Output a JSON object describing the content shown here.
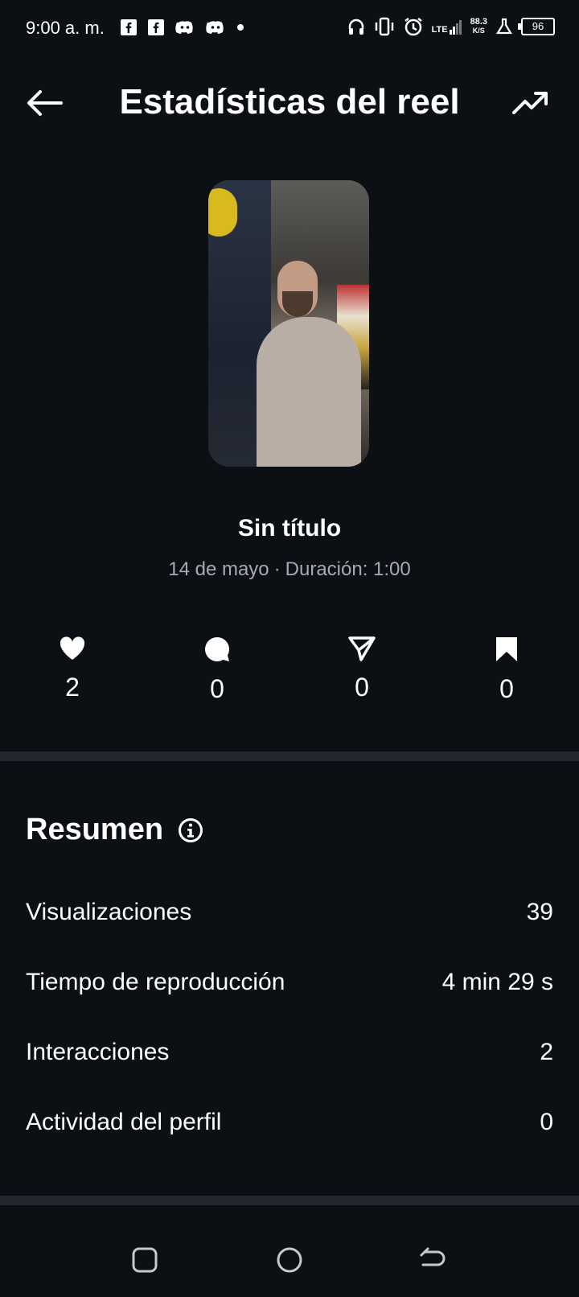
{
  "status_bar": {
    "time": "9:00 a. m.",
    "net_speed_value": "88.3",
    "net_speed_unit": "K/S",
    "lte": "LTE",
    "battery": "96",
    "left_icons": [
      "facebook-icon",
      "facebook-icon",
      "discord-icon",
      "discord-icon",
      "dot-icon"
    ],
    "right_icons": [
      "headphones-icon",
      "vibrate-icon",
      "alarm-icon",
      "lte-signal-icon",
      "flask-icon",
      "battery-icon"
    ]
  },
  "header": {
    "title": "Estadísticas del reel",
    "back_icon": "arrow-left-icon",
    "trend_icon": "trending-up-icon"
  },
  "reel": {
    "title": "Sin título",
    "date": "14 de mayo",
    "separator": "·",
    "duration": "Duración: 1:00"
  },
  "engagement": [
    {
      "icon": "heart-icon",
      "value": "2"
    },
    {
      "icon": "comment-icon",
      "value": "0"
    },
    {
      "icon": "share-icon",
      "value": "0"
    },
    {
      "icon": "bookmark-icon",
      "value": "0"
    }
  ],
  "summary": {
    "title": "Resumen",
    "rows": [
      {
        "label": "Visualizaciones",
        "value": "39"
      },
      {
        "label": "Tiempo de reproducción",
        "value": "4 min 29 s"
      },
      {
        "label": "Interacciones",
        "value": "2"
      },
      {
        "label": "Actividad del perfil",
        "value": "0"
      }
    ]
  },
  "nav": [
    "recents-icon",
    "home-icon",
    "back-icon"
  ],
  "colors": {
    "background": "#0c0f14",
    "divider": "#232830",
    "muted_text": "#a6aab2",
    "text": "#ffffff"
  }
}
